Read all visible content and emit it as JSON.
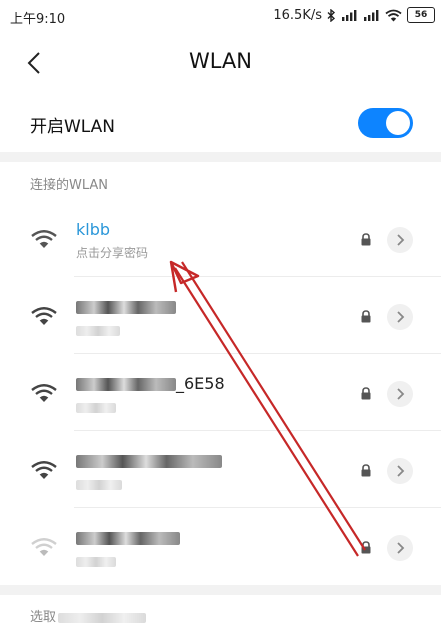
{
  "status_bar": {
    "time": "上午9:10",
    "speed": "16.5K/s",
    "battery": "56",
    "icons": [
      "bluetooth-icon",
      "signal-icon",
      "signal-icon",
      "wifi-icon",
      "battery-icon"
    ]
  },
  "header": {
    "title": "WLAN",
    "back_icon": "chevron-left-icon"
  },
  "wlan_toggle": {
    "label": "开启WLAN",
    "state": "on",
    "color": "#0d84ff"
  },
  "connected_section": {
    "header": "连接的WLAN",
    "network": {
      "name": "klbb",
      "subtitle": "点击分享密码",
      "name_color": "#2b97d9"
    }
  },
  "saved_networks": [
    {
      "name_visible": "",
      "obscured": true,
      "secured": true
    },
    {
      "name_visible": "_6E58",
      "obscured": true,
      "secured": true
    },
    {
      "name_visible": "",
      "obscured": true,
      "secured": true
    },
    {
      "name_visible": "",
      "obscured": true,
      "secured": true,
      "weak_signal": true
    }
  ],
  "bottom_section": {
    "header_visible": "选取"
  },
  "annotation": {
    "type": "arrow",
    "color": "#c62828"
  }
}
